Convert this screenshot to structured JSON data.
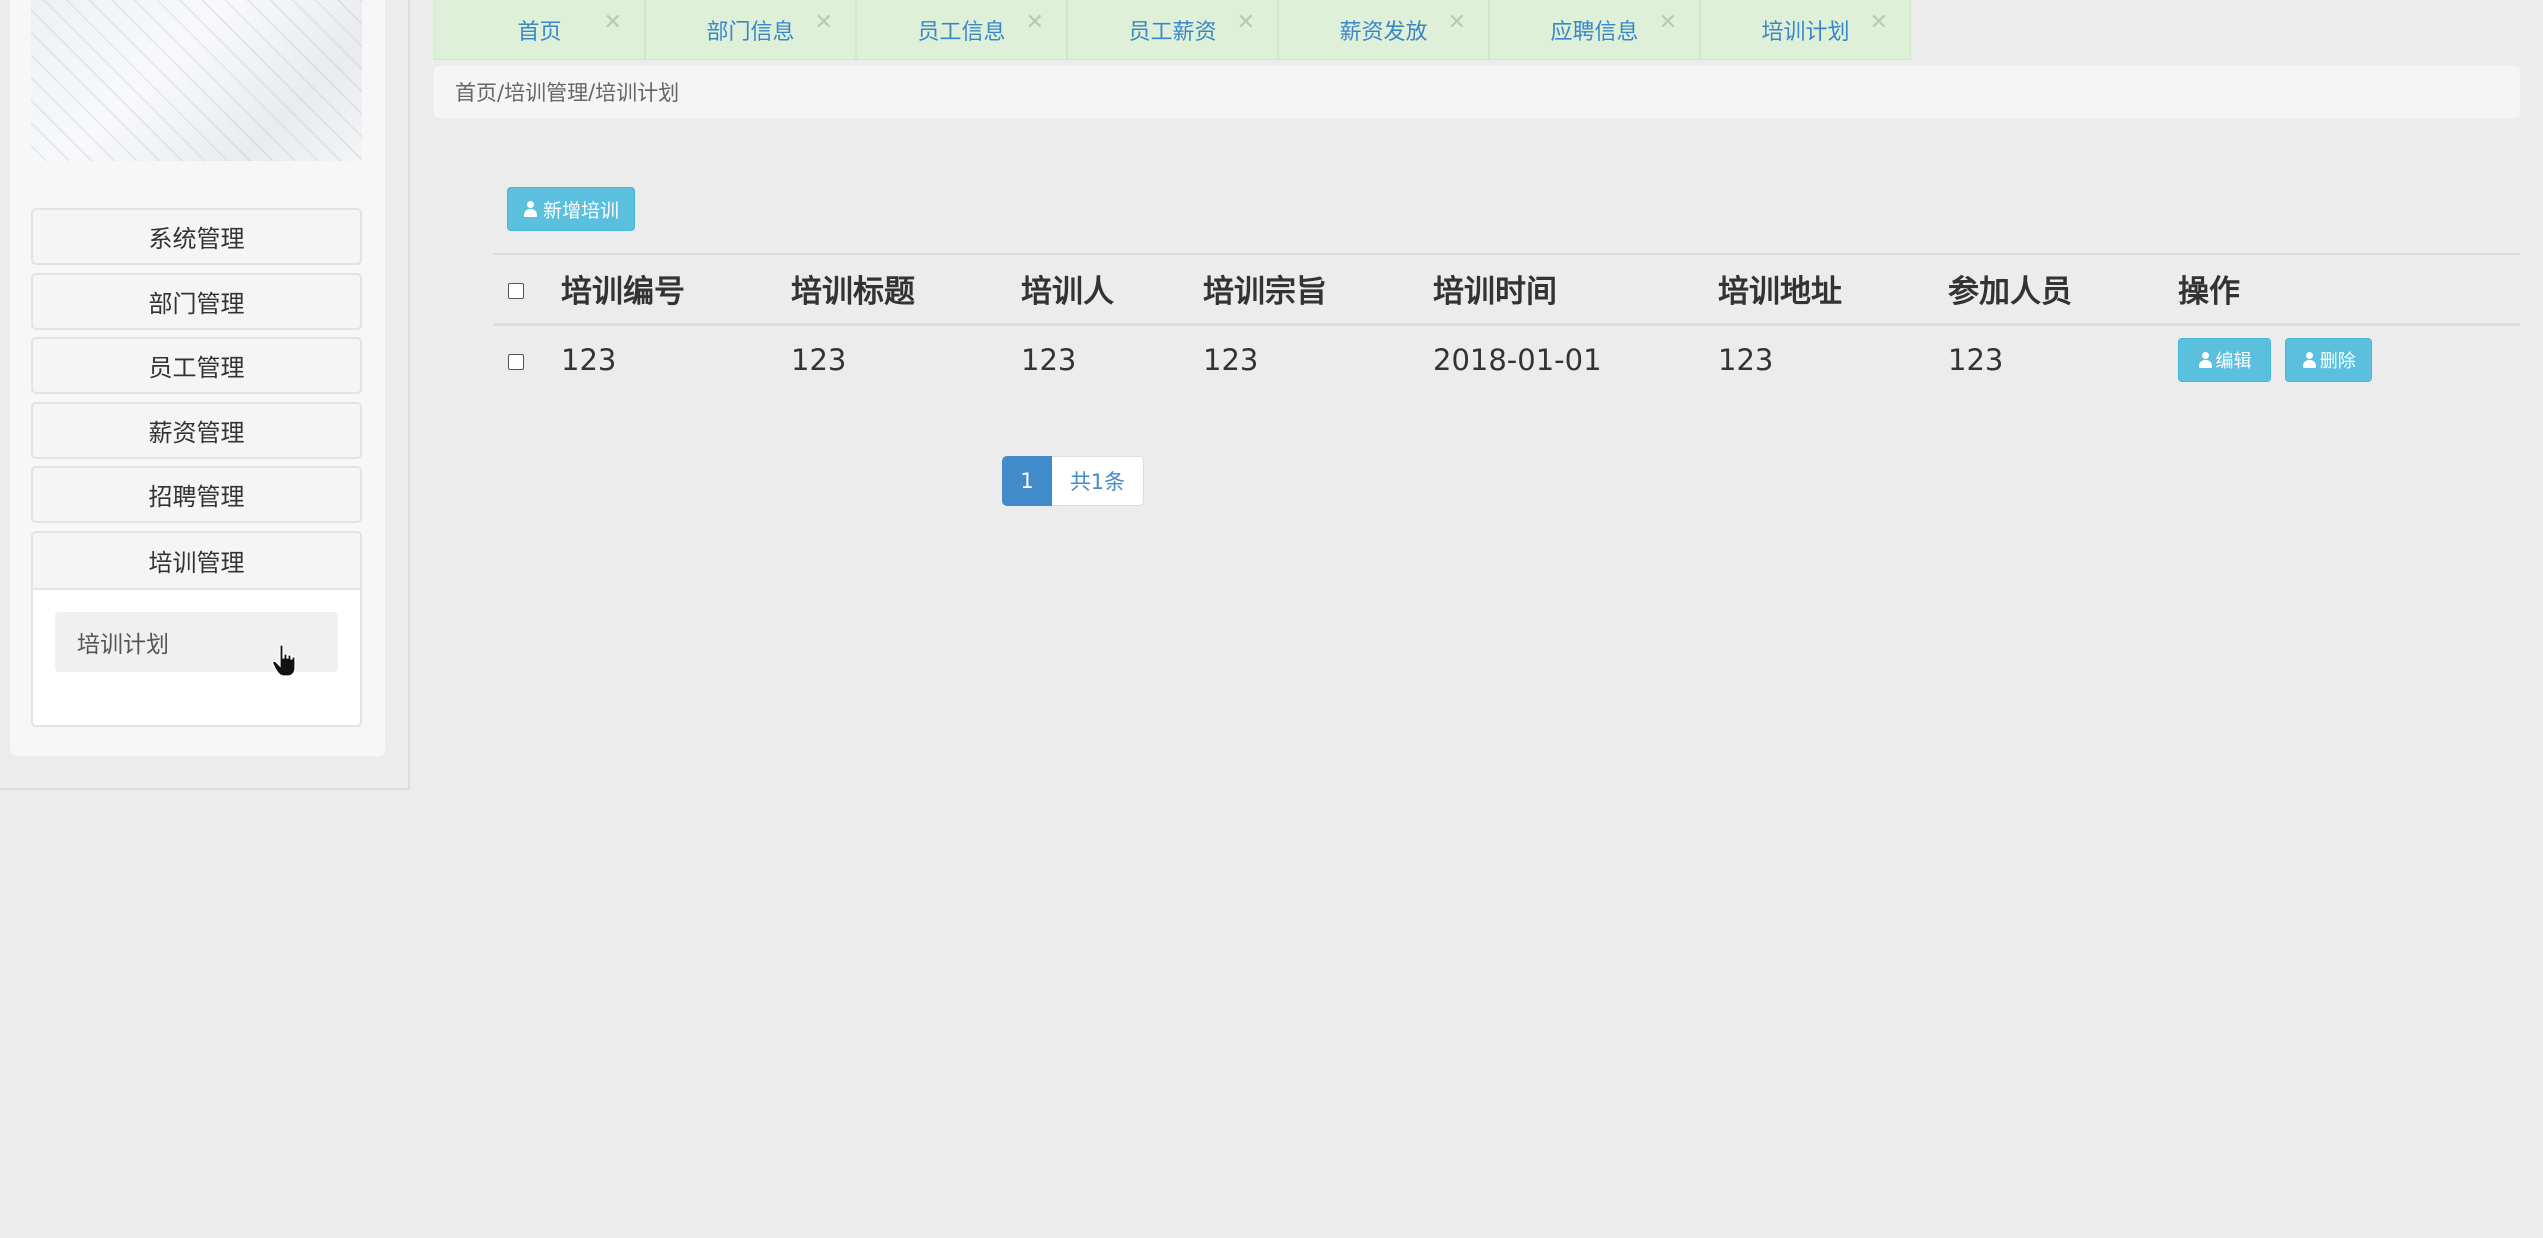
{
  "sidebar": {
    "menu": [
      {
        "label": "系统管理"
      },
      {
        "label": "部门管理"
      },
      {
        "label": "员工管理"
      },
      {
        "label": "薪资管理"
      },
      {
        "label": "招聘管理"
      }
    ],
    "active_group": {
      "label": "培训管理",
      "submenu": [
        {
          "label": "培训计划"
        }
      ]
    }
  },
  "tabs": [
    {
      "label": "首页",
      "close": "✕"
    },
    {
      "label": "部门信息",
      "close": "✕"
    },
    {
      "label": "员工信息",
      "close": "✕"
    },
    {
      "label": "员工薪资",
      "close": "✕"
    },
    {
      "label": "薪资发放",
      "close": "✕"
    },
    {
      "label": "应聘信息",
      "close": "✕"
    },
    {
      "label": "培训计划",
      "close": "✕"
    }
  ],
  "breadcrumb": {
    "home": "首页/",
    "section": " 培训管理",
    "separator": " / ",
    "current": "培训计划"
  },
  "toolbar": {
    "add_label": "新增培训",
    "add_icon": "user-icon"
  },
  "table": {
    "headers": [
      "培训编号",
      "培训标题",
      "培训人",
      "培训宗旨",
      "培训时间",
      "培训地址",
      "参加人员",
      "操作"
    ],
    "rows": [
      {
        "id": "123",
        "title": "123",
        "trainer": "123",
        "purpose": "123",
        "time": "2018-01-01",
        "address": "123",
        "participants": "123",
        "edit_label": "编辑",
        "delete_label": "删除"
      }
    ]
  },
  "pagination": {
    "current_page": "1",
    "total": "共1条"
  },
  "colors": {
    "tab_bg": "#dff0d8",
    "tab_text": "#3a87c8",
    "info_button": "#5bc0de",
    "primary": "#428bca",
    "background": "#ececec"
  }
}
